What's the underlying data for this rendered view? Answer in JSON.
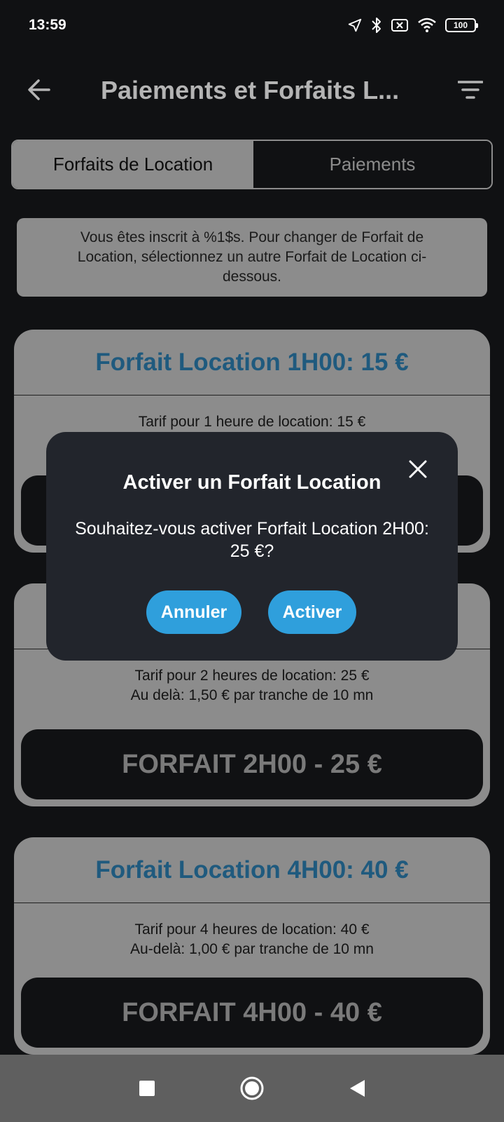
{
  "status_bar": {
    "time": "13:59",
    "battery": "100",
    "icons": [
      "location-arrow-icon",
      "bluetooth-icon",
      "sim-off-icon",
      "wifi-icon",
      "battery-icon"
    ]
  },
  "app_bar": {
    "title": "Paiements et Forfaits L...",
    "back_icon": "arrow-left-icon",
    "filter_icon": "filter-icon"
  },
  "tabs": [
    {
      "label": "Forfaits de Location",
      "active": true
    },
    {
      "label": "Paiements",
      "active": false
    }
  ],
  "info": {
    "text": "Vous êtes inscrit à %1$s. Pour changer de Forfait de Location, sélectionnez un autre Forfait de Location ci-dessous."
  },
  "plans": [
    {
      "title": "Forfait Location 1H00: 15 €",
      "desc_line1": "Tarif pour 1 heure de location: 15 €",
      "desc_line2": "",
      "button": ""
    },
    {
      "title": "",
      "desc_line1": "Tarif pour 2 heures de location: 25 €",
      "desc_line2": "Au delà: 1,50 € par tranche de 10 mn",
      "button": "FORFAIT 2H00 - 25 €"
    },
    {
      "title": "Forfait Location 4H00: 40 €",
      "desc_line1": "Tarif pour 4 heures de location: 40 €",
      "desc_line2": "Au-delà: 1,00 € par tranche de 10 mn",
      "button": "FORFAIT 4H00 - 40 €"
    }
  ],
  "dialog": {
    "title": "Activer un Forfait Location",
    "message": "Souhaitez-vous activer Forfait Location 2H00: 25 €?",
    "cancel_label": "Annuler",
    "confirm_label": "Activer",
    "close_icon": "close-icon"
  },
  "nav_bar": {
    "icons": [
      "recents-square-icon",
      "home-circle-icon",
      "back-triangle-icon"
    ]
  },
  "colors": {
    "background": "#101113",
    "card": "#8c8c8c",
    "plan_title": "#1f5a7e",
    "dialog_bg": "#22252c",
    "accent_button": "#2f9fdc",
    "nav_bar": "#5f5f5f"
  }
}
